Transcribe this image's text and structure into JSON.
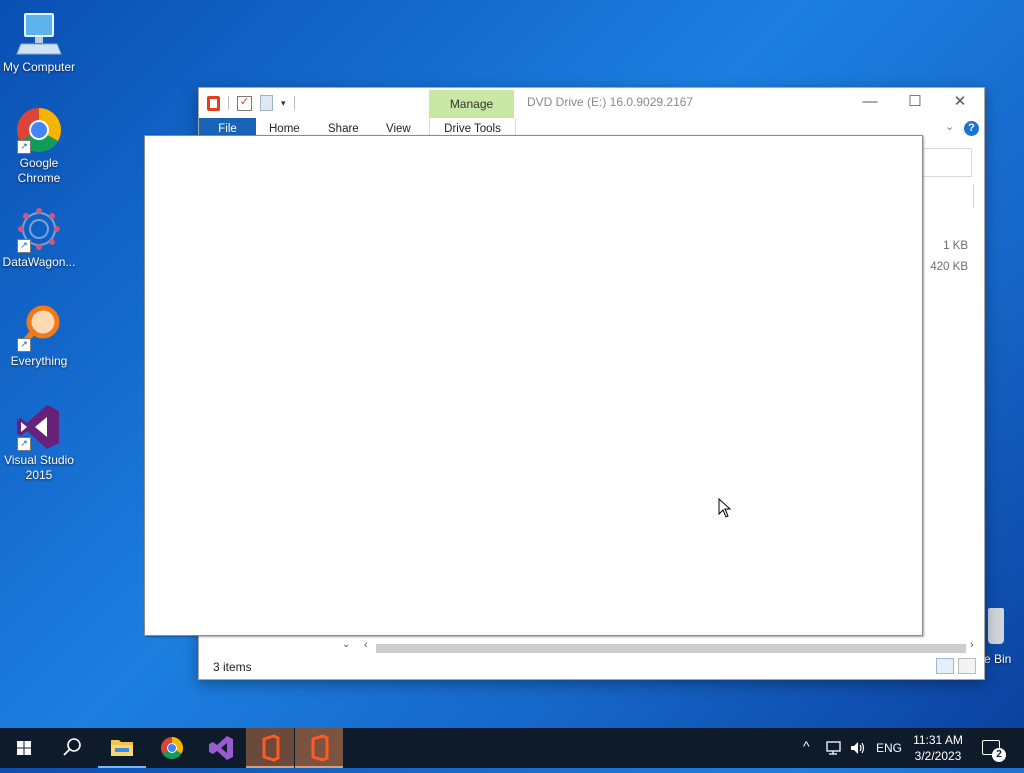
{
  "desktop": {
    "icons": [
      {
        "label": "My Computer"
      },
      {
        "label": "Google Chrome"
      },
      {
        "label": "DataWagon..."
      },
      {
        "label": "Everything"
      },
      {
        "label": "Visual Studio 2015"
      }
    ],
    "recycle_bin_label": "e Bin"
  },
  "explorer": {
    "title": "DVD Drive (E:) 16.0.9029.2167",
    "contextual_tab": "Manage",
    "ribbon_tabs": [
      "File",
      "Home",
      "Share",
      "View",
      "Drive Tools"
    ],
    "file_sizes": [
      "1 KB",
      "420 KB"
    ],
    "status": "3 items",
    "window_buttons": {
      "minimize": "—",
      "maximize": "☐",
      "close": "✕"
    },
    "help_label": "?"
  },
  "taskbar": {
    "language": "ENG",
    "time": "11:31 AM",
    "date": "3/2/2023",
    "notifications_count": "2"
  },
  "colors": {
    "desktop_blue": "#1d7fe0",
    "ribbon_file_tab": "#1964b7",
    "manage_tab": "#c9e8a6",
    "taskbar": "#0d1b2b",
    "office_red": "#e0401a"
  }
}
